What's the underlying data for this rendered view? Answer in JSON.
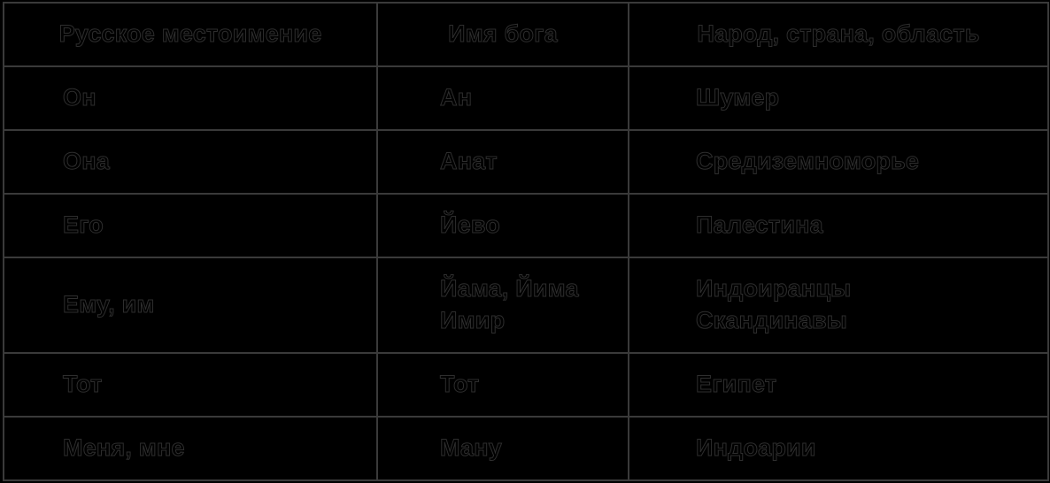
{
  "table": {
    "columns": [
      {
        "key": "pronoun",
        "header": "Русское местоимение",
        "align": "center"
      },
      {
        "key": "deity",
        "header": "Имя бога",
        "align": "center"
      },
      {
        "key": "region",
        "header": "Народ, страна, область",
        "align": "center"
      }
    ],
    "rows": [
      {
        "pronoun": "Он",
        "deity": "Ан",
        "region": "Шумер",
        "tall": false
      },
      {
        "pronoun": "Она",
        "deity": "Анат",
        "region": "Средиземноморье",
        "tall": false
      },
      {
        "pronoun": "Его",
        "deity": "Йево",
        "region": "Палестина",
        "tall": false
      },
      {
        "pronoun": "Ему, им",
        "deity": "Йама, Йима\nИмир",
        "region": "Индоиранцы\nСкандинавы",
        "tall": true
      },
      {
        "pronoun": "Тот",
        "deity": "Тот",
        "region": "Египет",
        "tall": false
      },
      {
        "pronoun": "Меня, мне",
        "deity": "Ману",
        "region": "Индоарии",
        "tall": false
      }
    ]
  },
  "colors": {
    "background": "#000000",
    "border": "#3a3a3a",
    "text_stroke": "#2e2e2e",
    "text_fill": "#000000"
  }
}
